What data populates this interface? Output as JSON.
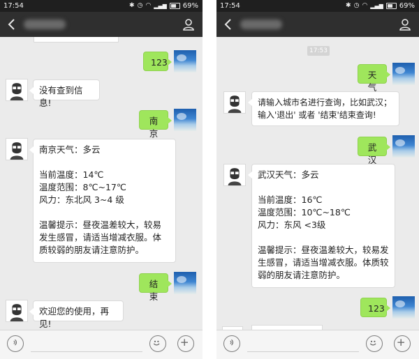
{
  "left": {
    "status": {
      "time": "17:54",
      "battery": "69%"
    },
    "messages": [
      {
        "from": "user",
        "text": "123"
      },
      {
        "from": "bot",
        "text": "没有查到信息!"
      },
      {
        "from": "user",
        "text": "南京"
      },
      {
        "from": "bot",
        "text": "南京天气：多云\n\n当前温度：14℃\n温度范围：8℃~17℃\n风力：东北风 3~4 级\n\n温馨提示：昼夜温差较大，较易发生感冒，请适当增减衣服。体质较弱的朋友请注意防护。"
      },
      {
        "from": "user",
        "text": "结束"
      },
      {
        "from": "bot",
        "text": "欢迎您的使用，再见!"
      }
    ]
  },
  "right": {
    "status": {
      "time": "17:54",
      "battery": "69%"
    },
    "timestamp": "17:53",
    "messages": [
      {
        "from": "user",
        "text": "天气"
      },
      {
        "from": "bot",
        "text": "请输入城市名进行查询，比如武汉；\n输入'退出' 或者 '结束'结束查询!"
      },
      {
        "from": "user",
        "text": "武汉"
      },
      {
        "from": "bot",
        "text": "武汉天气：多云\n\n当前温度：16℃\n温度范围：10℃~18℃\n风力：东风 <3级\n\n温馨提示：昼夜温差较大，较易发生感冒，请适当增减衣服。体质较弱的朋友请注意防护。"
      },
      {
        "from": "user",
        "text": "123"
      }
    ]
  },
  "icons": {
    "back": "chevron-left-icon",
    "profile": "person-icon",
    "voice": "voice-icon",
    "emoji": "emoji-icon",
    "add": "plus-icon"
  },
  "colors": {
    "titlebar": "#2f2f2f",
    "chat_background": "#ebebeb",
    "user_bubble": "#9fe65c",
    "bot_bubble": "#ffffff"
  }
}
